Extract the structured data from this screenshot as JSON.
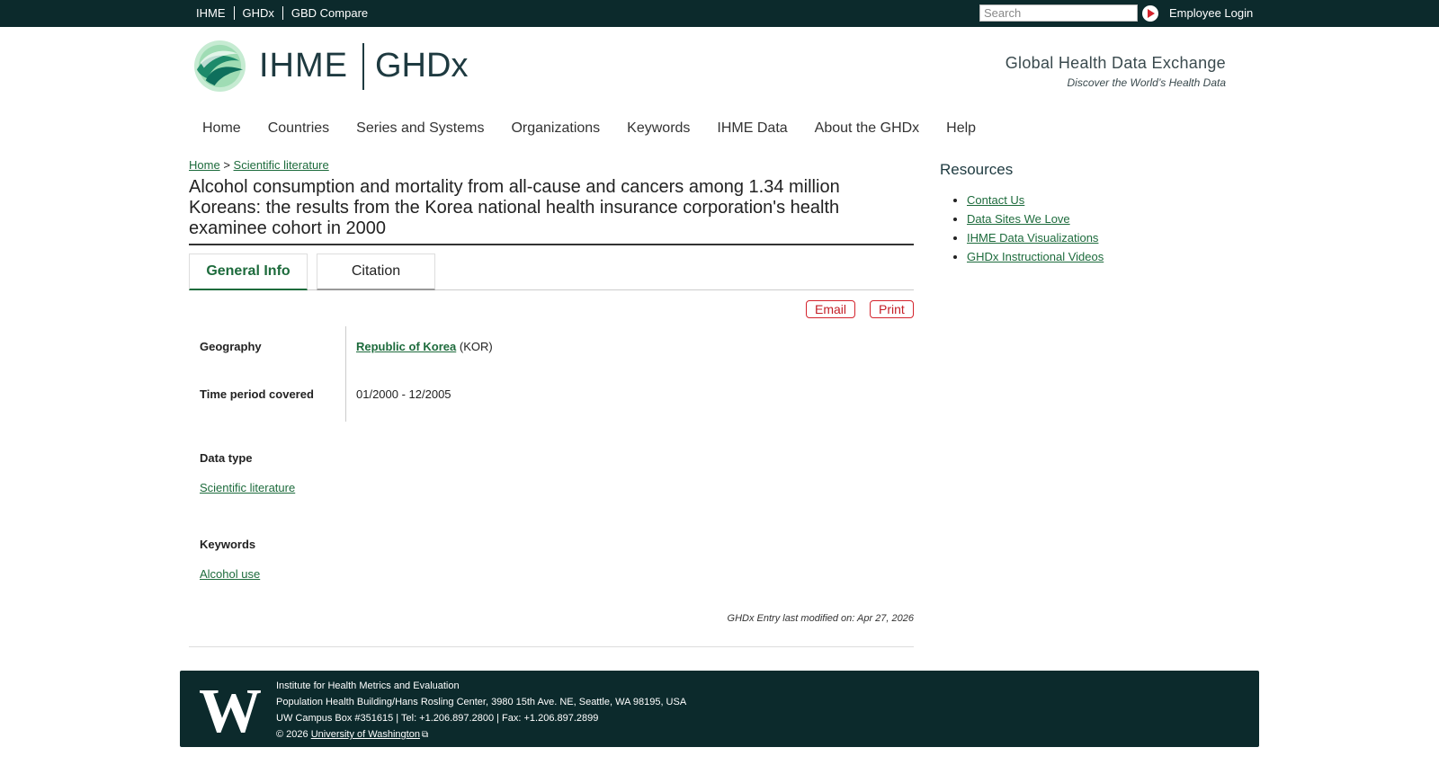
{
  "topbar": {
    "links": [
      "IHME",
      "GHDx",
      "GBD Compare"
    ],
    "search_placeholder": "Search",
    "employee_login": "Employee Login"
  },
  "header": {
    "logo_ihme": "IHME",
    "logo_ghdx": "GHDx",
    "tagline_main": "Global Health Data Exchange",
    "tagline_sub": "Discover the World’s Health Data"
  },
  "nav": [
    "Home",
    "Countries",
    "Series and Systems",
    "Organizations",
    "Keywords",
    "IHME Data",
    "About the GHDx",
    "Help"
  ],
  "breadcrumb": {
    "home": "Home",
    "separator": ">",
    "current": "Scientific literature"
  },
  "page_title": "Alcohol consumption and mortality from all-cause and cancers among 1.34 million Koreans: the results from the Korea national health insurance corporation's health examinee cohort in 2000",
  "tabs": {
    "general": "General Info",
    "citation": "Citation"
  },
  "actions": {
    "email": "Email",
    "print": "Print"
  },
  "info": {
    "geography_label": "Geography",
    "geography_link": "Republic of Korea",
    "geography_code": "(KOR)",
    "time_label": "Time period covered",
    "time_value": "01/2000 - 12/2005"
  },
  "data_type": {
    "label": "Data type",
    "value": "Scientific literature"
  },
  "keywords": {
    "label": "Keywords",
    "value": "Alcohol use"
  },
  "last_modified": "GHDx Entry last modified on: Apr 27, 2026",
  "sidebar": {
    "heading": "Resources",
    "items": [
      "Contact Us",
      "Data Sites We Love",
      "IHME Data Visualizations",
      "GHDx Instructional Videos"
    ]
  },
  "footer": {
    "line1": "Institute for Health Metrics and Evaluation",
    "line2": "Population Health Building/Hans Rosling Center, 3980 15th Ave. NE, Seattle, WA 98195, USA",
    "line3": "UW Campus Box #351615 | Tel: +1.206.897.2800 | Fax: +1.206.897.2899",
    "copyright": "© 2026",
    "uw_link": "University of Washington",
    "uw_logo": "W"
  },
  "colors": {
    "topbar": "#0c2a2c",
    "link": "#1d6b3c",
    "accent_red": "#d4232c"
  }
}
